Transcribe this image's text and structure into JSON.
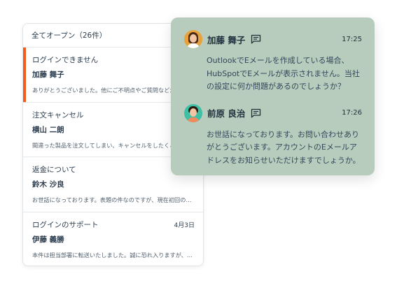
{
  "list": {
    "header": "全てオープン（26件）",
    "tickets": [
      {
        "subject": "ログインできません",
        "date": "",
        "name": "加藤 舞子",
        "preview": "ありがとうございました。他にご不明点やご質問などがありましたら"
      },
      {
        "subject": "注文キャンセル",
        "date": "",
        "name": "横山 二朗",
        "preview": "間違った製品を注文してしまい、キャンセルをしたくご連絡しました"
      },
      {
        "subject": "返金について",
        "date": "",
        "name": "鈴木 沙良",
        "preview": "お世話になっております。表題の件なのですが、現在初回の…"
      },
      {
        "subject": "ログインのサポート",
        "date": "4月3日",
        "name": "伊藤 義勝",
        "preview": "本件は担当部署に転送いたしました。誠に恐れ入りますが、…"
      }
    ]
  },
  "chat": {
    "messages": [
      {
        "sender": "加藤 舞子",
        "time": "17:25",
        "text": "OutlookでEメールを作成している場合、HubSpotでEメールが表示されません。当社の設定に何か問題があるのでしょうか？",
        "avatar_icon": "avatar-woman"
      },
      {
        "sender": "前原 良治",
        "time": "17:26",
        "text": "お世話になっております。お問い合わせありがとうございます。アカウントのEメールアドレスをお知らせいただけますでしょうか。",
        "avatar_icon": "avatar-man"
      }
    ]
  },
  "colors": {
    "accent": "#f25a1b",
    "chat_bg": "#b7ccbc",
    "text": "#2d3e50"
  }
}
